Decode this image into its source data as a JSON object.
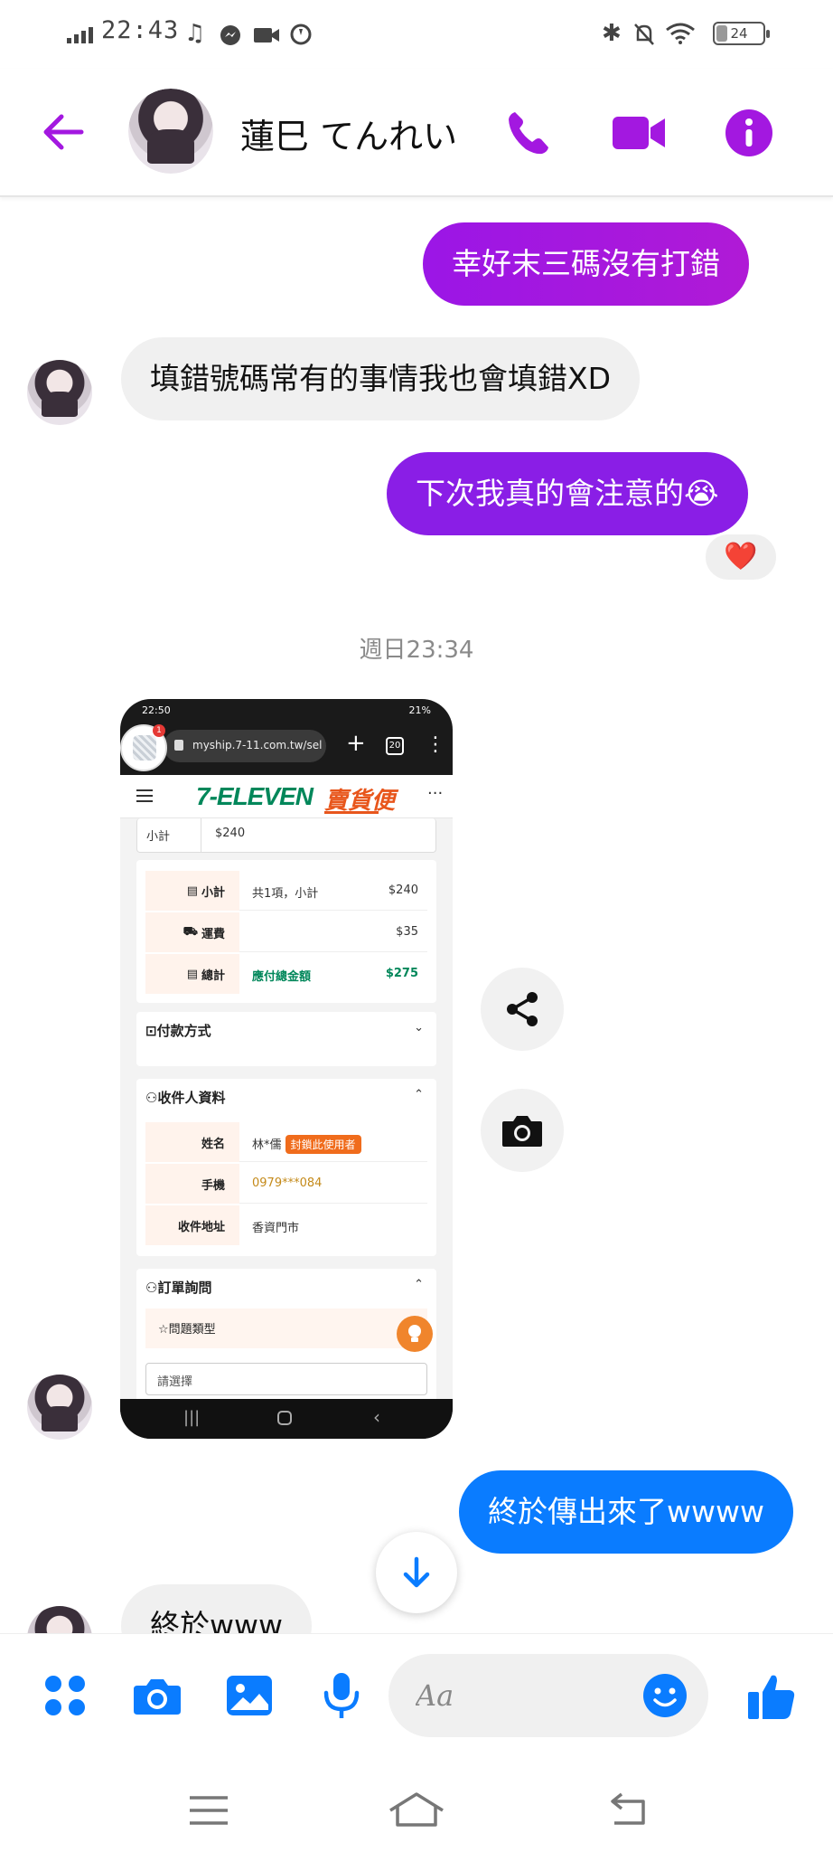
{
  "status_bar": {
    "time": "22:43",
    "battery": "24",
    "battery_level": 0.24
  },
  "header": {
    "contact_name": "蓮巳 てんれい"
  },
  "messages": [
    {
      "text": "幸好末三碼沒有打錯",
      "direction": "outgoing"
    },
    {
      "text": "填錯號碼常有的事情我也會填錯XD",
      "direction": "incoming"
    },
    {
      "text": "下次我真的會注意的😭",
      "direction": "outgoing",
      "reaction": "❤️"
    },
    {
      "text": "終於傳出來了wwww",
      "direction": "outgoing"
    },
    {
      "text": "終於www",
      "direction": "incoming"
    }
  ],
  "timestamp": "週日23:34",
  "shared_screenshot": {
    "status_time": "22:50",
    "status_right": "21%",
    "url": "myship.7-11.com.tw/sel",
    "tab_count": "20",
    "notification_count": "1",
    "brand": "7-ELEVEN",
    "brand_service": "賣貨便",
    "subtotal_top_label": "小計",
    "subtotal_top_value": "$240",
    "summary": [
      {
        "label": "小計",
        "desc": "共1項，小計",
        "amount": "$240"
      },
      {
        "label": "運費",
        "desc": "",
        "amount": "$35"
      },
      {
        "label": "總計",
        "desc": "應付總金額",
        "amount": "$275"
      }
    ],
    "payment_section": "付款方式",
    "recipient_section": "收件人資料",
    "recipient": [
      {
        "label": "姓名",
        "value": "林*儒",
        "tag": "封鎖此使用者"
      },
      {
        "label": "手機",
        "value": "0979***084"
      },
      {
        "label": "收件地址",
        "value": "香資門市"
      }
    ],
    "inquiry_section": "訂單詢問",
    "question_type_label": "問題類型",
    "select_placeholder": "請選擇"
  },
  "composer": {
    "placeholder": "Aa"
  },
  "colors": {
    "accent_purple": "#a318e0",
    "messenger_blue": "#0a7cff",
    "seven_green": "#00875a",
    "seven_orange": "#e8561c"
  }
}
